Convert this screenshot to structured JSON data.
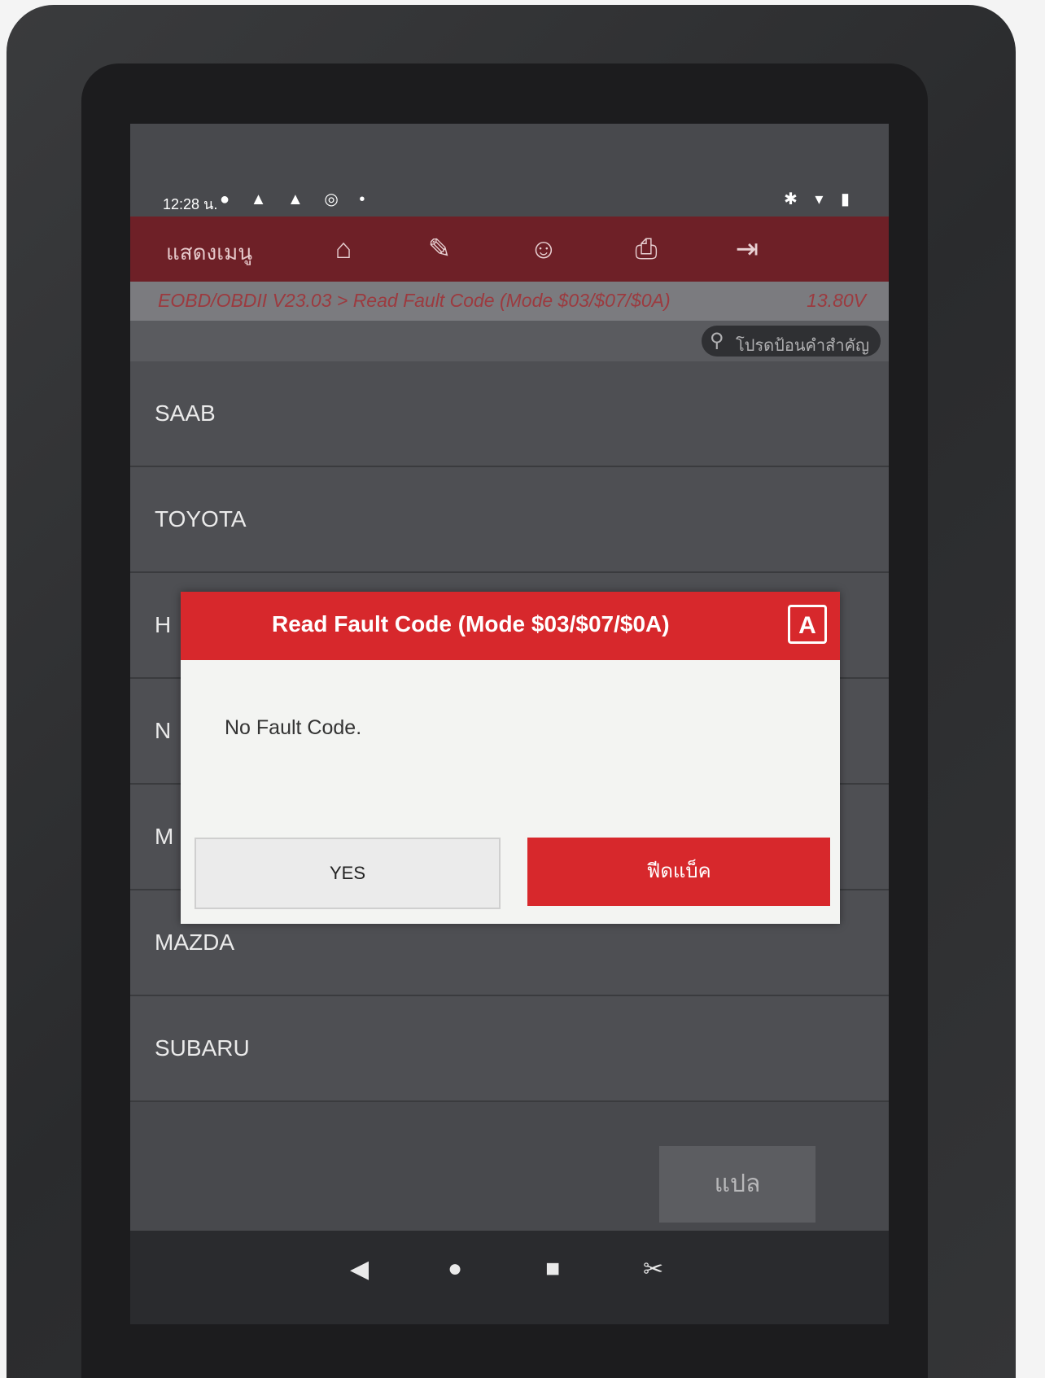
{
  "status_bar": {
    "time": "12:28 น.",
    "icons": "● ▲ ▲ ◎ •",
    "right_icons": "✱ ▾ ▮"
  },
  "top_bar": {
    "menu_label": "แสดงเมนู",
    "icons": {
      "home": "⌂",
      "report": "✎",
      "user": "☺",
      "print": "⎙",
      "exit": "⇥"
    }
  },
  "breadcrumb": {
    "path": "EOBD/OBDII V23.03 > Read Fault Code (Mode $03/$07/$0A)",
    "voltage": "13.80V"
  },
  "search": {
    "placeholder": "โปรดป้อนคำสำคัญ",
    "icon": "⚲"
  },
  "list": {
    "items": [
      {
        "label": "SAAB"
      },
      {
        "label": "TOYOTA"
      },
      {
        "label": "H"
      },
      {
        "label": "N"
      },
      {
        "label": "M"
      },
      {
        "label": "MAZDA"
      },
      {
        "label": "SUBARU"
      }
    ]
  },
  "translate_button": "แปล",
  "system_nav": {
    "back": "◀",
    "home": "●",
    "recents": "■",
    "screenshot": "✂"
  },
  "dialog": {
    "title": "Read Fault Code (Mode $03/$07/$0A)",
    "icon": "A",
    "message": "No Fault Code.",
    "yes_label": "YES",
    "feedback_label": "ฟีดแบ็ค"
  },
  "colors": {
    "accent_red": "#d7282c",
    "topbar": "#6e2027"
  }
}
